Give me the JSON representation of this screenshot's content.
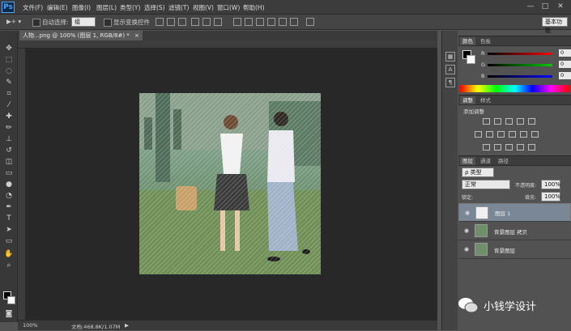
{
  "app": {
    "logo": "Ps"
  },
  "menu": [
    "文件(F)",
    "编辑(E)",
    "图像(I)",
    "图层(L)",
    "类型(Y)",
    "选择(S)",
    "滤镜(T)",
    "视图(V)",
    "窗口(W)",
    "帮助(H)"
  ],
  "window_controls": {
    "minimize": "—",
    "restore": "□",
    "close": "✕"
  },
  "options": {
    "auto_select_label": "自动选择:",
    "auto_select_value": "组",
    "show_transform_label": "显示变换控件",
    "workspace": "基本功能"
  },
  "document": {
    "tab_title": "人物...png @ 100% (图层 1, RGB/8#) *",
    "tab_close": "×",
    "zoom": "100%",
    "doc_size": "文档:468.8K/1.07M"
  },
  "color_panel": {
    "tabs": [
      "颜色",
      "色板"
    ],
    "sliders": [
      {
        "label": "R",
        "value": "0",
        "gradient": "#ff0000"
      },
      {
        "label": "G",
        "value": "0",
        "gradient": "#00cc00"
      },
      {
        "label": "B",
        "value": "0",
        "gradient": "#0000ff"
      }
    ]
  },
  "adjust_panel": {
    "tabs": [
      "调整",
      "样式"
    ],
    "title": "添加调整"
  },
  "layers_panel": {
    "tabs": [
      "图层",
      "通道",
      "路径"
    ],
    "filter_label": "ρ 类型",
    "blend_mode": "正常",
    "opacity_label": "不透明度:",
    "opacity_value": "100%",
    "lock_label": "锁定:",
    "fill_label": "填充:",
    "fill_value": "100%",
    "layers": [
      {
        "name": "图层 1",
        "selected": true
      },
      {
        "name": "背景图层 拷贝",
        "selected": false
      },
      {
        "name": "背景图层",
        "selected": false
      }
    ]
  },
  "watermark": "小钱学设计",
  "colors": {
    "accent": "#4aa3ff",
    "panel_bg": "#525252",
    "canvas_bg": "#282828",
    "selected_layer": "#7a8796"
  }
}
